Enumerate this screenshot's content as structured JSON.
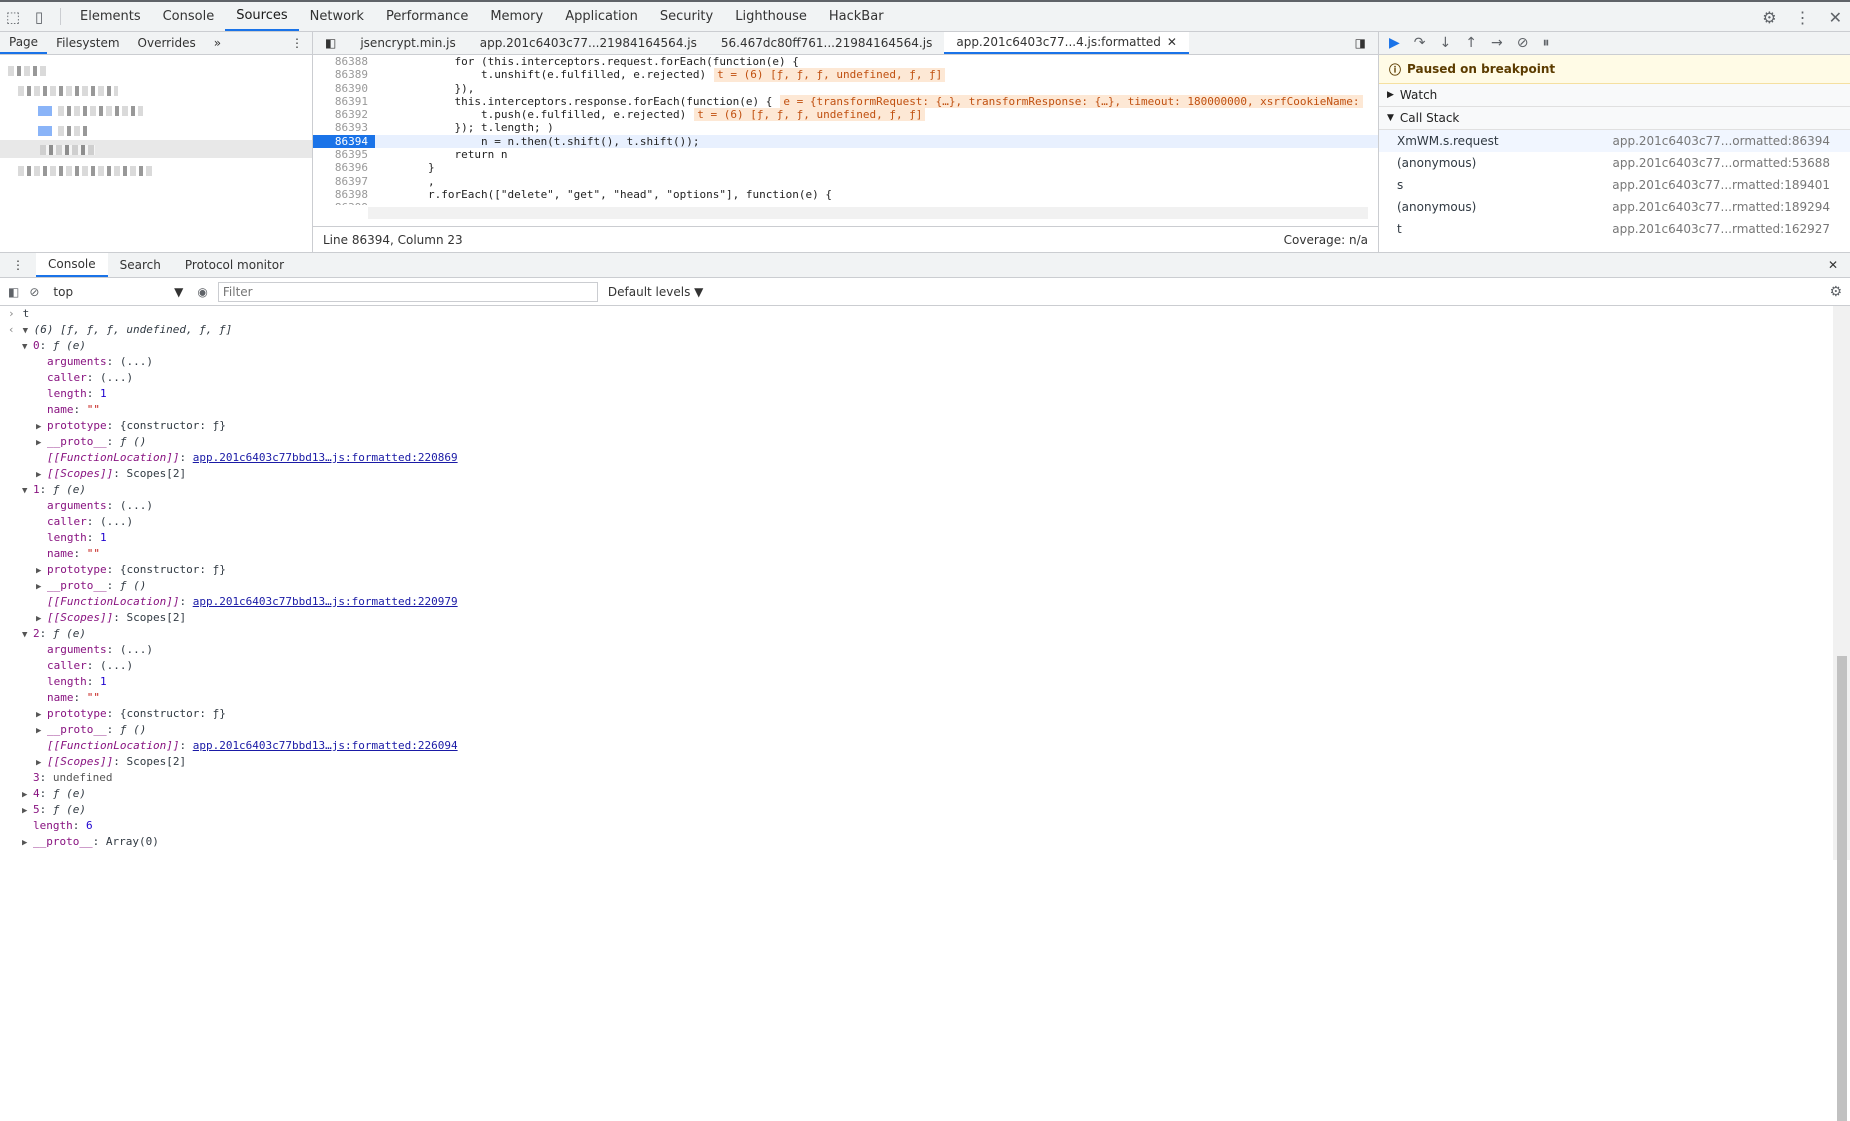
{
  "main_tabs": [
    "Elements",
    "Console",
    "Sources",
    "Network",
    "Performance",
    "Memory",
    "Application",
    "Security",
    "Lighthouse",
    "HackBar"
  ],
  "active_main_tab": "Sources",
  "navigator": {
    "tabs": [
      "Page",
      "Filesystem",
      "Overrides"
    ],
    "more": "»"
  },
  "file_tabs": [
    "jsencrypt.min.js",
    "app.201c6403c77...21984164564.js",
    "56.467dc80ff761...21984164564.js",
    "app.201c6403c77...4.js:formatted"
  ],
  "code_lines": [
    {
      "num": "86388",
      "text": "            for (this.interceptors.request.forEach(function(e) {"
    },
    {
      "num": "86389",
      "text": "                t.unshift(e.fulfilled, e.rejected)",
      "inline": "t = (6) [ƒ, ƒ, ƒ, undefined, ƒ, ƒ]"
    },
    {
      "num": "86390",
      "text": "            }),"
    },
    {
      "num": "86391",
      "text": "            this.interceptors.response.forEach(function(e) {",
      "inline": "e = {transformRequest: {…}, transformResponse: {…}, timeout: 180000000, xsrfCookieName:"
    },
    {
      "num": "86392",
      "text": "                t.push(e.fulfilled, e.rejected)",
      "inline": "t = (6) [ƒ, ƒ, ƒ, undefined, ƒ, ƒ]"
    },
    {
      "num": "86393",
      "text": "            }); t.length; )"
    },
    {
      "num": "86394",
      "text": "                n = n.then(t.shift(), t.shift());",
      "hl": true
    },
    {
      "num": "86395",
      "text": "            return n"
    },
    {
      "num": "86396",
      "text": "        }"
    },
    {
      "num": "86397",
      "text": "        ,"
    },
    {
      "num": "86398",
      "text": "        r.forEach([\"delete\", \"get\", \"head\", \"options\"], function(e) {"
    },
    {
      "num": "86399",
      "text": ""
    }
  ],
  "editor_status": {
    "position": "Line 86394, Column 23",
    "coverage": "Coverage: n/a"
  },
  "debugger": {
    "paused_text": "Paused on breakpoint",
    "watch_label": "Watch",
    "call_stack_label": "Call Stack",
    "frames": [
      {
        "name": "XmWM.s.request",
        "loc": "app.201c6403c77...ormatted:86394"
      },
      {
        "name": "(anonymous)",
        "loc": "app.201c6403c77...ormatted:53688"
      },
      {
        "name": "s",
        "loc": "app.201c6403c77...rmatted:189401"
      },
      {
        "name": "(anonymous)",
        "loc": "app.201c6403c77...rmatted:189294"
      },
      {
        "name": "t",
        "loc": "app.201c6403c77...rmatted:162927"
      }
    ]
  },
  "drawer_tabs": [
    "Console",
    "Search",
    "Protocol monitor"
  ],
  "console_toolbar": {
    "context": "top",
    "filter_placeholder": "Filter",
    "levels": "Default levels ▼"
  },
  "console_lines": [
    {
      "indent": 0,
      "text": "t",
      "kind": "input"
    },
    {
      "indent": 0,
      "text": "(6) [ƒ, ƒ, ƒ, undefined, ƒ, ƒ]",
      "kind": "result"
    },
    {
      "indent": 1,
      "tri": "▼",
      "key": "0",
      "val": "ƒ (e)"
    },
    {
      "indent": 2,
      "key": "arguments",
      "val": "(...)"
    },
    {
      "indent": 2,
      "key": "caller",
      "val": "(...)"
    },
    {
      "indent": 2,
      "key": "length",
      "val": "1"
    },
    {
      "indent": 2,
      "key": "name",
      "val": "\"\""
    },
    {
      "indent": 2,
      "tri": "▶",
      "key": "prototype",
      "val": "{constructor: ƒ}"
    },
    {
      "indent": 2,
      "tri": "▶",
      "key": "__proto__",
      "val": "ƒ ()"
    },
    {
      "indent": 2,
      "key": "[[FunctionLocation]]",
      "link": "app.201c6403c77bbd13…js:formatted:220869"
    },
    {
      "indent": 2,
      "tri": "▶",
      "key": "[[Scopes]]",
      "val": "Scopes[2]"
    },
    {
      "indent": 1,
      "tri": "▼",
      "key": "1",
      "val": "ƒ (e)"
    },
    {
      "indent": 2,
      "key": "arguments",
      "val": "(...)"
    },
    {
      "indent": 2,
      "key": "caller",
      "val": "(...)"
    },
    {
      "indent": 2,
      "key": "length",
      "val": "1"
    },
    {
      "indent": 2,
      "key": "name",
      "val": "\"\""
    },
    {
      "indent": 2,
      "tri": "▶",
      "key": "prototype",
      "val": "{constructor: ƒ}"
    },
    {
      "indent": 2,
      "tri": "▶",
      "key": "__proto__",
      "val": "ƒ ()"
    },
    {
      "indent": 2,
      "key": "[[FunctionLocation]]",
      "link": "app.201c6403c77bbd13…js:formatted:220979"
    },
    {
      "indent": 2,
      "tri": "▶",
      "key": "[[Scopes]]",
      "val": "Scopes[2]"
    },
    {
      "indent": 1,
      "tri": "▼",
      "key": "2",
      "val": "ƒ (e)"
    },
    {
      "indent": 2,
      "key": "arguments",
      "val": "(...)"
    },
    {
      "indent": 2,
      "key": "caller",
      "val": "(...)"
    },
    {
      "indent": 2,
      "key": "length",
      "val": "1"
    },
    {
      "indent": 2,
      "key": "name",
      "val": "\"\""
    },
    {
      "indent": 2,
      "tri": "▶",
      "key": "prototype",
      "val": "{constructor: ƒ}"
    },
    {
      "indent": 2,
      "tri": "▶",
      "key": "__proto__",
      "val": "ƒ ()"
    },
    {
      "indent": 2,
      "key": "[[FunctionLocation]]",
      "link": "app.201c6403c77bbd13…js:formatted:226094"
    },
    {
      "indent": 2,
      "tri": "▶",
      "key": "[[Scopes]]",
      "val": "Scopes[2]"
    },
    {
      "indent": 1,
      "key": "3",
      "val": "undefined"
    },
    {
      "indent": 1,
      "tri": "▶",
      "key": "4",
      "val": "ƒ (e)"
    },
    {
      "indent": 1,
      "tri": "▶",
      "key": "5",
      "val": "ƒ (e)"
    },
    {
      "indent": 1,
      "key": "length",
      "val": "6"
    },
    {
      "indent": 1,
      "tri": "▶",
      "key": "__proto__",
      "val": "Array(0)"
    }
  ]
}
